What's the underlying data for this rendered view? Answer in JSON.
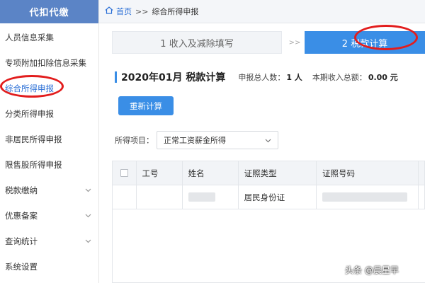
{
  "sidebar": {
    "header": "代扣代缴",
    "items": [
      {
        "label": "人员信息采集",
        "chevron": false
      },
      {
        "label": "专项附加扣除信息采集",
        "chevron": false
      },
      {
        "label": "综合所得申报",
        "chevron": false,
        "active": true
      },
      {
        "label": "分类所得申报",
        "chevron": false
      },
      {
        "label": "非居民所得申报",
        "chevron": false
      },
      {
        "label": "限售股所得申报",
        "chevron": false
      },
      {
        "label": "税款缴纳",
        "chevron": true
      },
      {
        "label": "优惠备案",
        "chevron": true
      },
      {
        "label": "查询统计",
        "chevron": true
      },
      {
        "label": "系统设置",
        "chevron": false
      }
    ]
  },
  "breadcrumb": {
    "home": "首页",
    "separator": ">>",
    "current": "综合所得申报"
  },
  "steps": {
    "step1": "1 收入及减除填写",
    "arrow": ">>",
    "step2": "2 税款计算"
  },
  "summary": {
    "title": "2020年01月 税款计算",
    "count_label": "申报总人数：",
    "count_value": "1 人",
    "income_label": "本期收入总额：",
    "income_value": "0.00 元"
  },
  "recalc_button": "重新计算",
  "filter": {
    "label": "所得项目：",
    "value": "正常工资薪金所得"
  },
  "table": {
    "headers": [
      "工号",
      "姓名",
      "证照类型",
      "证照号码"
    ],
    "row": {
      "id_type": "居民身份证"
    }
  },
  "watermark": "头条 @晨星早",
  "colors": {
    "sidebar_header": "#5b84c6",
    "primary": "#3a8ee6",
    "active_link": "#2b6fd6",
    "annotation": "#e21d1d"
  }
}
